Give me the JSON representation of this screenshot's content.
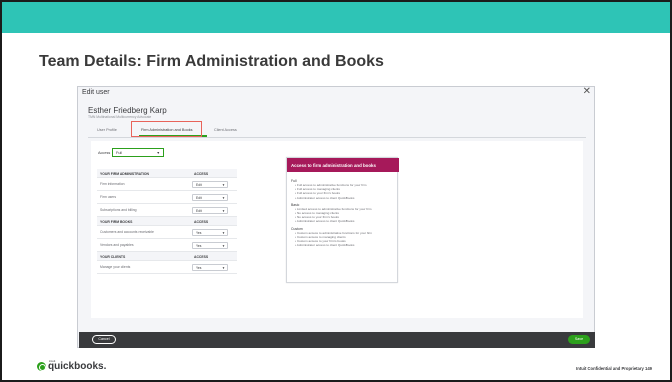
{
  "slide": {
    "title": "Team Details: Firm Administration and Books",
    "accent_color": "#2ec4b6",
    "confidential": "Intuit Confidential and Proprietary",
    "page_number": "149"
  },
  "modal": {
    "title": "Edit user",
    "close_glyph": "✕",
    "user_name": "Esther Friedberg Karp",
    "user_role": "TMN Multinational Multicurrency Advocate",
    "tabs": [
      {
        "label": "User Profile"
      },
      {
        "label": "Firm Administration and Books"
      },
      {
        "label": "Client Access"
      }
    ],
    "access": {
      "label": "Access",
      "value": "Full"
    },
    "sections": [
      {
        "header": "YOUR FIRM ADMINISTRATION",
        "column": "ACCESS",
        "rows": [
          {
            "label": "Firm information",
            "value": "Edit"
          },
          {
            "label": "Firm users",
            "value": "Edit"
          },
          {
            "label": "Subscriptions and billing",
            "value": "Edit"
          }
        ]
      },
      {
        "header": "YOUR FIRM BOOKS",
        "column": "ACCESS",
        "rows": [
          {
            "label": "Customers and accounts receivable",
            "value": "Yes"
          },
          {
            "label": "Vendors and payables",
            "value": "Yes"
          }
        ]
      },
      {
        "header": "YOUR CLIENTS",
        "column": "ACCESS",
        "rows": [
          {
            "label": "Manage your clients",
            "value": "Yes"
          }
        ]
      }
    ],
    "info_panel": {
      "title": "Access to firm administration and books",
      "header_color": "#a6195a",
      "groups": [
        {
          "title": "Full",
          "bullets": [
            "Full access to administrative functions for your firm",
            "Full access to managing clients",
            "Full access to your firm's books",
            "Administrator access to client QuickBooks"
          ]
        },
        {
          "title": "Basic",
          "bullets": [
            "Limited access to administrative functions for your firm",
            "No access to managing clients",
            "No access to your firm's books",
            "Administrator access to client QuickBooks"
          ]
        },
        {
          "title": "Custom",
          "bullets": [
            "Custom access to administrative functions for your firm",
            "Custom access to managing clients",
            "Custom access to your firm's books",
            "Administrator access to client QuickBooks"
          ]
        }
      ]
    },
    "footer": {
      "cancel_label": "Cancel",
      "save_label": "Save"
    }
  },
  "logo": {
    "intuit": "intuit",
    "wordmark": "quickbooks."
  }
}
